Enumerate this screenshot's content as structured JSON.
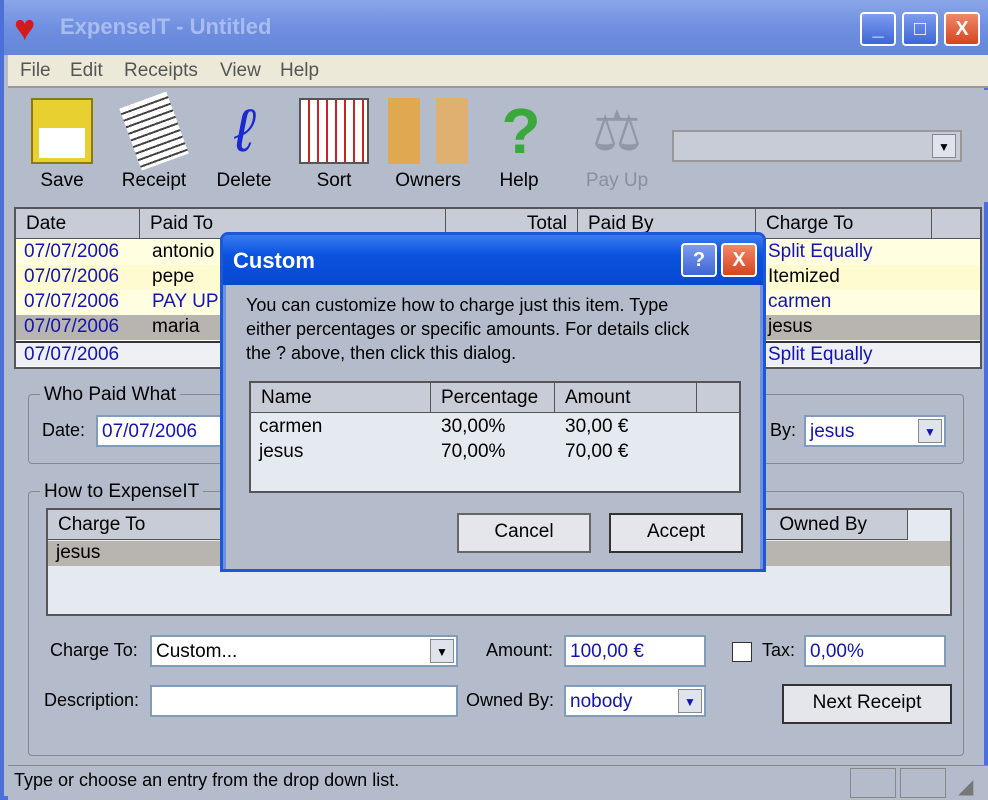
{
  "window": {
    "title": "ExpenseIT - Untitled",
    "minimize": "_",
    "maximize": "□",
    "close": "X"
  },
  "menu": [
    "File",
    "Edit",
    "Receipts",
    "View",
    "Help"
  ],
  "toolbar": {
    "items": [
      {
        "label": "Save",
        "icon": "floppy-disk-icon"
      },
      {
        "label": "Receipt",
        "icon": "receipt-icon"
      },
      {
        "label": "Delete",
        "icon": "delete-squiggle-icon"
      },
      {
        "label": "Sort",
        "icon": "calendar-icon"
      },
      {
        "label": "Owners",
        "icon": "faces-icon"
      },
      {
        "label": "Help",
        "icon": "question-mark-icon"
      },
      {
        "label": "Pay Up",
        "icon": "scales-icon",
        "disabled": true
      }
    ],
    "combo_value": ""
  },
  "list": {
    "columns": [
      "Date",
      "Paid To",
      "Total",
      "Paid By",
      "Charge To"
    ],
    "rows": [
      {
        "date": "07/07/2006",
        "paid_to": "antonio",
        "charge_to": "Split Equally"
      },
      {
        "date": "07/07/2006",
        "paid_to": "pepe",
        "charge_to": "Itemized"
      },
      {
        "date": "07/07/2006",
        "paid_to": "PAY UP",
        "charge_to": "carmen"
      },
      {
        "date": "07/07/2006",
        "paid_to": "maria",
        "charge_to": "jesus"
      },
      {
        "date": "07/07/2006",
        "paid_to": "",
        "charge_to": "Split Equally"
      }
    ]
  },
  "who_paid": {
    "label": "Who Paid What",
    "date_label": "Date:",
    "date": "07/07/2006",
    "paid_by_label": "By:",
    "paid_by": "jesus"
  },
  "how": {
    "label": "How to ExpenseIT",
    "columns": [
      "Charge To",
      "Owned By"
    ],
    "rows": [
      "jesus"
    ],
    "charge_to_label": "Charge To:",
    "charge_to": "Custom...",
    "amount_label": "Amount:",
    "amount": "100,00 €",
    "tax_label": "Tax:",
    "tax": "0,00%",
    "description_label": "Description:",
    "description": "",
    "owned_by_label": "Owned By:",
    "owned_by": "nobody",
    "next_receipt": "Next Receipt"
  },
  "status": "Type or choose an entry from the drop down list.",
  "dialog": {
    "title": "Custom",
    "help": "?",
    "close": "X",
    "text": [
      "You can customize how to charge just this item. Type",
      "either percentages or specific amounts.  For details click",
      "the ? above, then click this dialog."
    ],
    "columns": [
      "Name",
      "Percentage",
      "Amount"
    ],
    "rows": [
      {
        "name": "carmen",
        "pct": "30,00%",
        "amount": "30,00 €"
      },
      {
        "name": "jesus",
        "pct": "70,00%",
        "amount": "70,00 €"
      }
    ],
    "cancel": "Cancel",
    "accept": "Accept"
  }
}
